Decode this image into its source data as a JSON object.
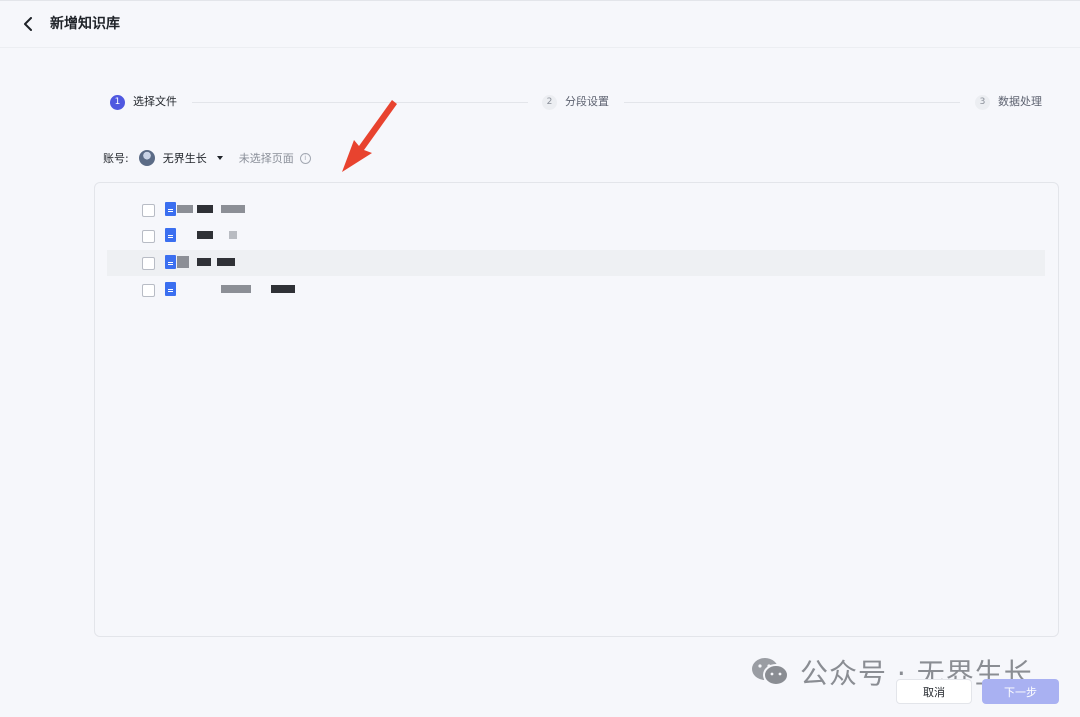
{
  "header": {
    "title": "新增知识库"
  },
  "steps": [
    {
      "index": "1",
      "label": "选择文件",
      "state": "active"
    },
    {
      "index": "2",
      "label": "分段设置",
      "state": "inactive"
    },
    {
      "index": "3",
      "label": "数据处理",
      "state": "inactive"
    }
  ],
  "account": {
    "label": "账号:",
    "name": "无界生长",
    "page_hint": "未选择页面",
    "info_icon": "info-icon"
  },
  "files": [
    {
      "checked": false,
      "icon": "doc-icon"
    },
    {
      "checked": false,
      "icon": "doc-icon"
    },
    {
      "checked": false,
      "icon": "doc-icon",
      "hovered": true
    },
    {
      "checked": false,
      "icon": "doc-icon"
    }
  ],
  "watermark": {
    "text": "公众号 · 无界生长"
  },
  "footer": {
    "cancel_label": "取消",
    "next_label": "下一步"
  },
  "colors": {
    "accent": "#4f58e0",
    "next_disabled": "#a9b1f2",
    "doc_icon": "#3b6ff0",
    "arrow": "#e8432f"
  }
}
